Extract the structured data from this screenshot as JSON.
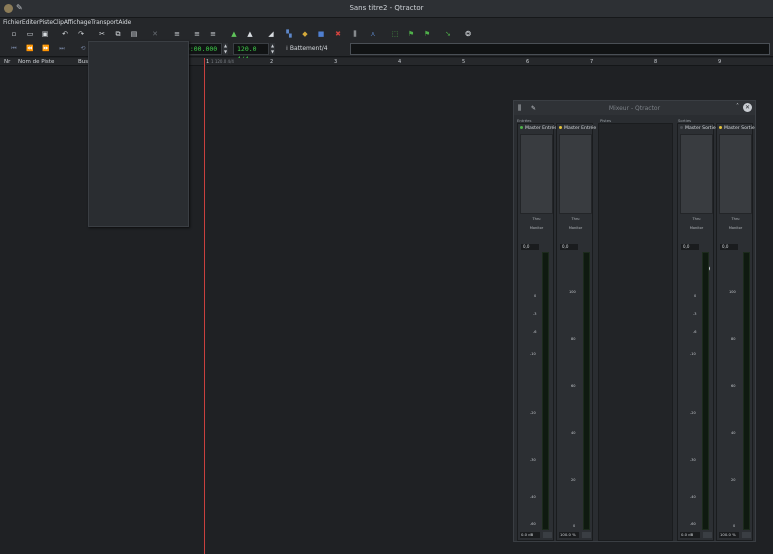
{
  "window": {
    "title": "Sans titre2 - Qtractor"
  },
  "menu": [
    "Fichier",
    "Editer",
    "Piste",
    "Clip",
    "Affichage",
    "Transport",
    "Aide"
  ],
  "toolbar": {
    "icons": [
      "new-icon",
      "open-icon",
      "save-icon",
      "undo-icon",
      "redo-icon",
      "cut-icon",
      "copy-icon",
      "paste-icon",
      "delete-icon",
      "track-add-icon",
      "track-remove-icon",
      "track-properties-icon",
      "clip-new-icon",
      "clip-edit-icon",
      "clip-tools-icon",
      "view-files-icon",
      "view-connections-icon",
      "view-messages-icon",
      "view-stop-icon",
      "view-mixer-icon",
      "view-metro-icon",
      "loop-icon",
      "marker-next-icon",
      "marker-prev-icon",
      "punch-icon",
      "settings-icon"
    ]
  },
  "transport": {
    "time": "00:00.000",
    "tempo": "120.0 4/4",
    "snap": "Battement/4"
  },
  "tracks": {
    "col_number": "Nr",
    "col_name": "Nom de Piste",
    "col_bus": "Bus"
  },
  "ruler": {
    "position_label": "1 120.0 4/4",
    "bars": [
      "1",
      "2",
      "3",
      "4",
      "5",
      "6",
      "7",
      "8",
      "9"
    ]
  },
  "mixer": {
    "title": "Mixeur - Qtractor",
    "sections": {
      "inputs": "Entrées",
      "tracks": "Pistes",
      "outputs": "Sorties"
    },
    "strips": [
      {
        "name": "Master Entrée",
        "dot_color": "#4fb04a",
        "buttons": [
          "Thru",
          "Monitor"
        ],
        "value": "0,0",
        "gain": "0.0 dB",
        "scale": [
          "6",
          "3",
          "0",
          "-3",
          "-6",
          "-10",
          "-20",
          "-30",
          "-40",
          "-60"
        ]
      },
      {
        "name": "Master Entrée",
        "dot_color": "#e3c23b",
        "buttons": [
          "Thru",
          "Monitor"
        ],
        "value": "0,0",
        "gain": "100.0 %",
        "scale": [
          "100",
          "80",
          "60",
          "40",
          "20",
          "0"
        ]
      },
      {
        "name": "Master Sortie",
        "dot_color": "#4b4f54",
        "buttons": [
          "Thru",
          "Monitor"
        ],
        "value": "0,0",
        "gain": "0.0 dB",
        "scale": [
          "6",
          "3",
          "0",
          "-3",
          "-6",
          "-10",
          "-20",
          "-30",
          "-40",
          "-60"
        ]
      },
      {
        "name": "Master Sortie",
        "dot_color": "#e3c23b",
        "buttons": [
          "Thru",
          "Monitor"
        ],
        "value": "0,0",
        "gain": "100.0 %",
        "scale": [
          "100",
          "80",
          "60",
          "40",
          "20",
          "0"
        ]
      }
    ]
  }
}
